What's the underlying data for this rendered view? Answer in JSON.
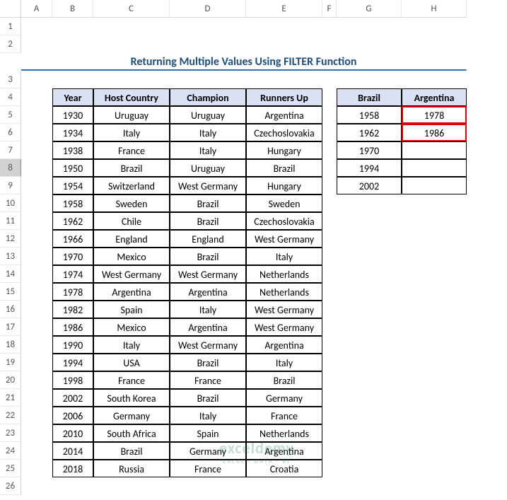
{
  "columns": [
    "A",
    "B",
    "C",
    "D",
    "E",
    "F",
    "G",
    "H"
  ],
  "title": "Returning Multiple Values Using FILTER Function",
  "main_table": {
    "headers": [
      "Year",
      "Host Country",
      "Champion",
      "Runners Up"
    ],
    "rows": [
      [
        "1930",
        "Uruguay",
        "Uruguay",
        "Argentina"
      ],
      [
        "1934",
        "Italy",
        "Italy",
        "Czechoslovakia"
      ],
      [
        "1938",
        "France",
        "Italy",
        "Hungary"
      ],
      [
        "1950",
        "Brazil",
        "Uruguay",
        "Brazil"
      ],
      [
        "1954",
        "Switzerland",
        "West Germany",
        "Hungary"
      ],
      [
        "1958",
        "Sweden",
        "Brazil",
        "Sweden"
      ],
      [
        "1962",
        "Chile",
        "Brazil",
        "Czechoslovakia"
      ],
      [
        "1966",
        "England",
        "England",
        "West Germany"
      ],
      [
        "1970",
        "Mexico",
        "Brazil",
        "Italy"
      ],
      [
        "1974",
        "West Germany",
        "West Germany",
        "Netherlands"
      ],
      [
        "1978",
        "Argentina",
        "Argentina",
        "Netherlands"
      ],
      [
        "1982",
        "Spain",
        "Italy",
        "West Germany"
      ],
      [
        "1986",
        "Mexico",
        "Argentina",
        "West Germany"
      ],
      [
        "1990",
        "Italy",
        "West Germany",
        "Argentina"
      ],
      [
        "1994",
        "USA",
        "Brazil",
        "Italy"
      ],
      [
        "1998",
        "France",
        "France",
        "Brazil"
      ],
      [
        "2002",
        "South Korea",
        "Brazil",
        "Germany"
      ],
      [
        "2006",
        "Germany",
        "Italy",
        "France"
      ],
      [
        "2010",
        "South Africa",
        "Spain",
        "Netherlands"
      ],
      [
        "2014",
        "Brazil",
        "Germany",
        "Argentina"
      ],
      [
        "2018",
        "Russia",
        "France",
        "Croatia"
      ]
    ]
  },
  "side_table": {
    "headers": [
      "Brazil",
      "Argentina"
    ],
    "rows": [
      [
        "1958",
        "1978"
      ],
      [
        "1962",
        "1986"
      ],
      [
        "1970",
        ""
      ],
      [
        "1994",
        ""
      ],
      [
        "2002",
        ""
      ]
    ],
    "highlight_cells": [
      [
        0,
        1
      ],
      [
        1,
        1
      ]
    ]
  },
  "selected_row": 8,
  "watermark": {
    "big": "exceldemy",
    "small": "EXCEL · DATA · BI"
  }
}
